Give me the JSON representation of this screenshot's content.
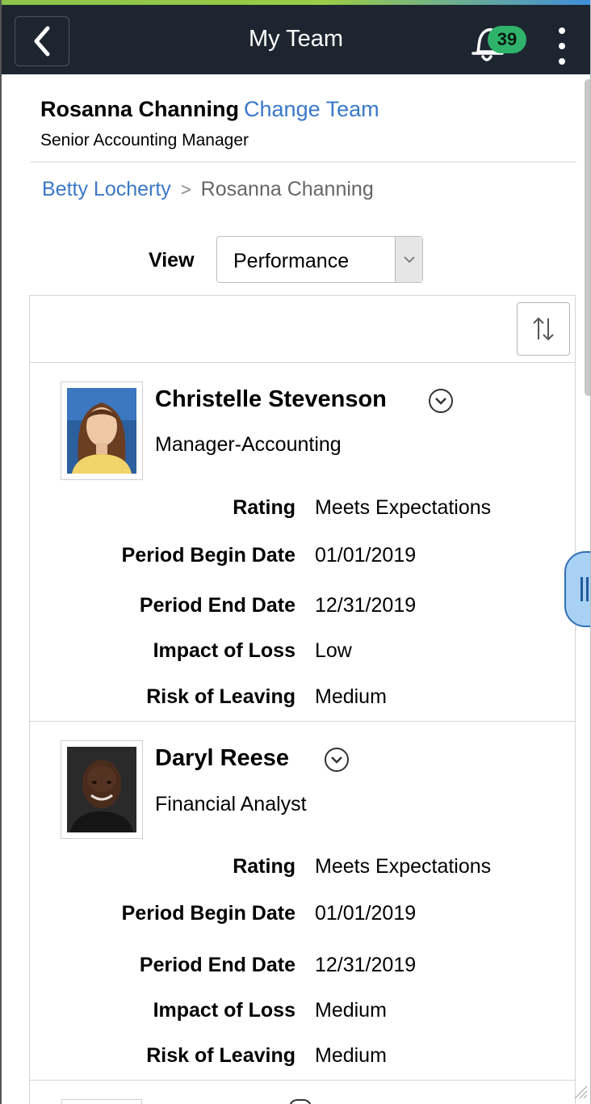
{
  "header": {
    "title": "My Team",
    "notification_count": "39"
  },
  "manager": {
    "name": "Rosanna Channing",
    "change_team_label": "Change Team",
    "job_title": "Senior Accounting Manager"
  },
  "breadcrumb": {
    "items": [
      "Betty Locherty",
      "Rosanna Channing"
    ],
    "separator": ">"
  },
  "view": {
    "label": "View",
    "selected": "Performance"
  },
  "employees": [
    {
      "name": "Christelle Stevenson",
      "role": "Manager-Accounting",
      "fields": [
        {
          "label": "Rating",
          "value": "Meets Expectations"
        },
        {
          "label": "Period Begin Date",
          "value": "01/01/2019"
        },
        {
          "label": "Period End Date",
          "value": "12/31/2019"
        },
        {
          "label": "Impact of Loss",
          "value": "Low"
        },
        {
          "label": "Risk of Leaving",
          "value": "Medium"
        }
      ]
    },
    {
      "name": "Daryl Reese",
      "role": "Financial Analyst",
      "fields": [
        {
          "label": "Rating",
          "value": "Meets Expectations"
        },
        {
          "label": "Period Begin Date",
          "value": "01/01/2019"
        },
        {
          "label": "Period End Date",
          "value": "12/31/2019"
        },
        {
          "label": "Impact of Loss",
          "value": "Medium"
        },
        {
          "label": "Risk of Leaving",
          "value": "Medium"
        }
      ]
    }
  ],
  "colors": {
    "header_bg": "#1d2630",
    "link": "#3a78c8",
    "badge": "#2fb36b",
    "handle": "#a8d1f4"
  },
  "icons": [
    "back-arrow-icon",
    "bell-icon",
    "kebab-menu-icon",
    "dropdown-arrow-icon",
    "sort-icon",
    "chevron-down-circle-icon",
    "panel-handle-icon"
  ]
}
